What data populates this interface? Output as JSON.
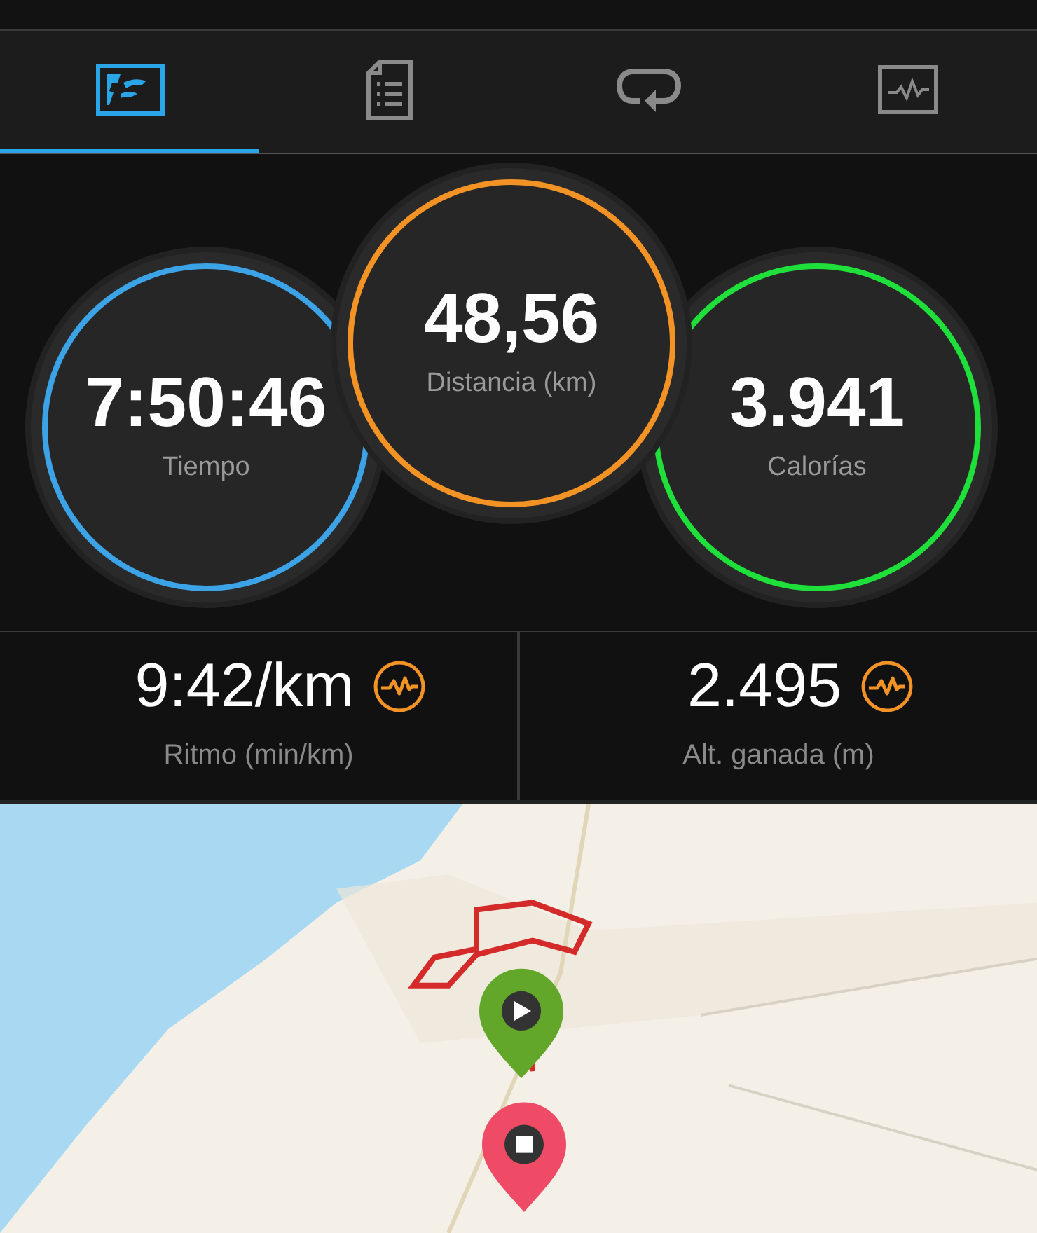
{
  "tabs": [
    {
      "kind": "map",
      "selected": true
    },
    {
      "kind": "document",
      "selected": false
    },
    {
      "kind": "laps",
      "selected": false
    },
    {
      "kind": "chart",
      "selected": false
    }
  ],
  "circles": [
    {
      "value": "7:50:46",
      "label": "Tiempo",
      "color": "#3ba3e6"
    },
    {
      "value": "48,56",
      "label": "Distancia (km)",
      "color": "#f39325"
    },
    {
      "value": "3.941",
      "label": "Calorías",
      "color": "#1fe03a"
    }
  ],
  "stats": [
    {
      "value": "9:42/km",
      "label": "Ritmo (min/km)"
    },
    {
      "value": "2.495",
      "label": "Alt. ganada (m)"
    }
  ]
}
